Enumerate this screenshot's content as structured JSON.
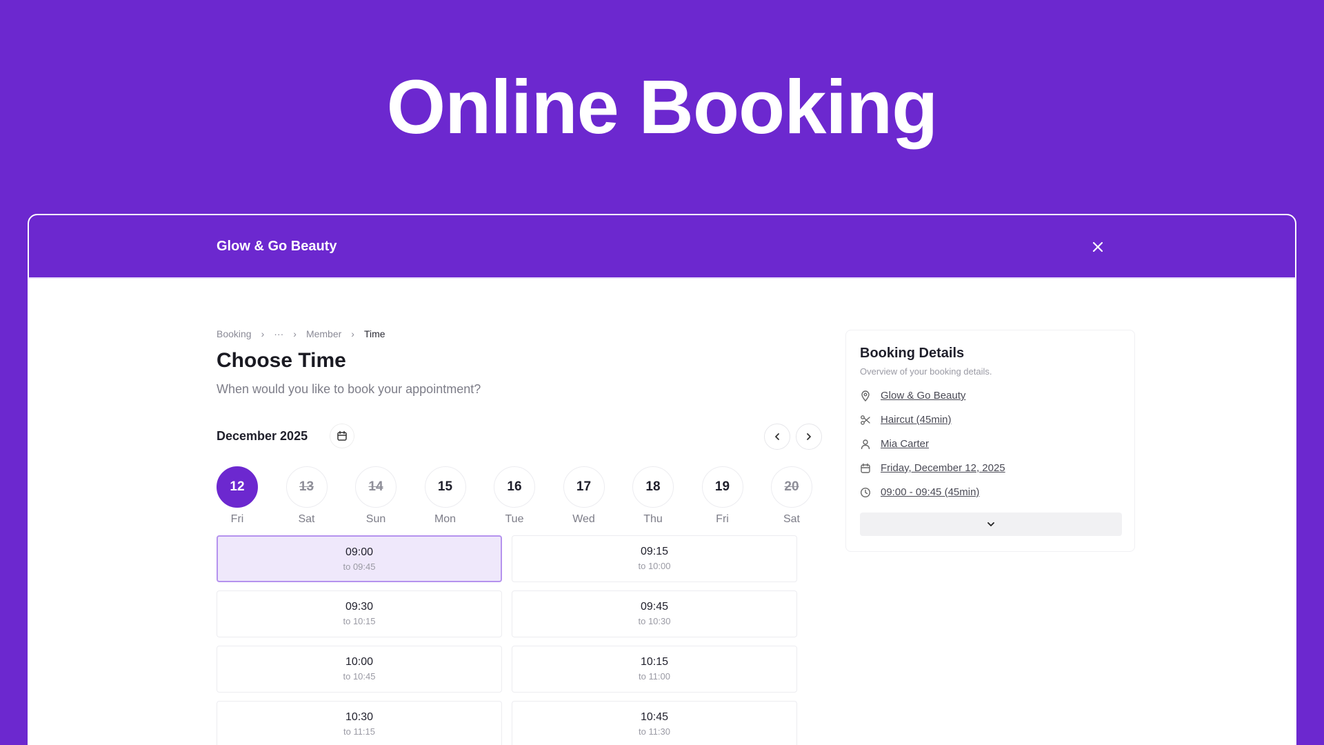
{
  "hero": {
    "title": "Online Booking"
  },
  "header": {
    "brand": "Glow & Go Beauty"
  },
  "breadcrumb": {
    "items": [
      "Booking",
      "···",
      "Member",
      "Time"
    ]
  },
  "page": {
    "title": "Choose Time",
    "subtitle": "When would you like to book your appointment?"
  },
  "calendar": {
    "month": "December 2025",
    "days": [
      {
        "num": "12",
        "label": "Fri",
        "state": "selected"
      },
      {
        "num": "13",
        "label": "Sat",
        "state": "disabled"
      },
      {
        "num": "14",
        "label": "Sun",
        "state": "disabled"
      },
      {
        "num": "15",
        "label": "Mon",
        "state": "available"
      },
      {
        "num": "16",
        "label": "Tue",
        "state": "available"
      },
      {
        "num": "17",
        "label": "Wed",
        "state": "available"
      },
      {
        "num": "18",
        "label": "Thu",
        "state": "available"
      },
      {
        "num": "19",
        "label": "Fri",
        "state": "available"
      },
      {
        "num": "20",
        "label": "Sat",
        "state": "disabled"
      }
    ]
  },
  "slots": [
    {
      "time": "09:00",
      "end": "to 09:45",
      "selected": true
    },
    {
      "time": "09:15",
      "end": "to 10:00",
      "selected": false
    },
    {
      "time": "09:30",
      "end": "to 10:15",
      "selected": false
    },
    {
      "time": "09:45",
      "end": "to 10:30",
      "selected": false
    },
    {
      "time": "10:00",
      "end": "to 10:45",
      "selected": false
    },
    {
      "time": "10:15",
      "end": "to 11:00",
      "selected": false
    },
    {
      "time": "10:30",
      "end": "to 11:15",
      "selected": false
    },
    {
      "time": "10:45",
      "end": "to 11:30",
      "selected": false
    }
  ],
  "details": {
    "title": "Booking Details",
    "subtitle": "Overview of your booking details.",
    "location": "Glow & Go Beauty",
    "service": "Haircut (45min)",
    "member": "Mia Carter",
    "date": "Friday, December 12, 2025",
    "time": "09:00 - 09:45 (45min)"
  },
  "colors": {
    "accent": "#6c28cf",
    "selected_slot_bg": "#efe8fb",
    "selected_slot_border": "#b592ee"
  }
}
